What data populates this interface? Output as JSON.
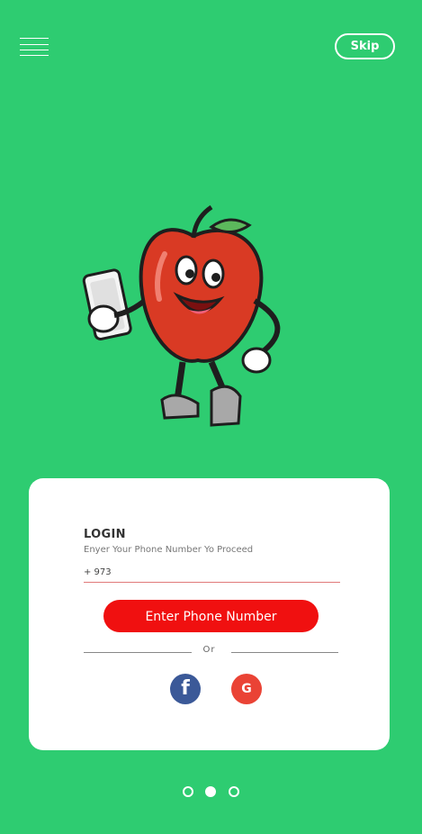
{
  "header": {
    "menu_icon": "hamburger-icon",
    "skip_label": "Skip"
  },
  "hero": {
    "illustration": "apple-mascot-holding-phone"
  },
  "login": {
    "title": "LOGIN",
    "subtitle": "Enyer Your Phone Number Yo Proceed",
    "country_code": "+ 973",
    "phone_value": "",
    "phone_placeholder": "",
    "cta_label": "Enter Phone Number",
    "divider_label": "Or",
    "facebook_glyph": "f",
    "google_glyph": "G",
    "social_icons": [
      "facebook-icon",
      "google-icon"
    ]
  },
  "pager": {
    "count": 3,
    "active_index": 1
  },
  "colors": {
    "background": "#2ecc71",
    "cta": "#f01010",
    "facebook": "#3b5998",
    "google": "#ea4335"
  }
}
